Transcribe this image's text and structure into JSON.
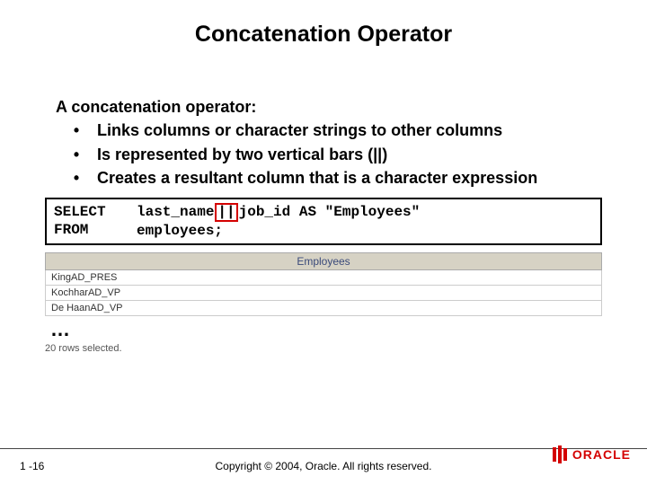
{
  "title": "Concatenation Operator",
  "lead": "A concatenation operator:",
  "bullets": [
    "Links columns or character strings to other columns",
    "Is represented by two vertical bars (||)",
    "Creates a resultant column that is a character expression"
  ],
  "code": {
    "kw1": "SELECT",
    "kw2": "FROM",
    "expr_pre": "last_name",
    "expr_op": "||",
    "expr_post": "job_id AS \"Employees\"",
    "from": "employees;"
  },
  "result": {
    "header": "Employees",
    "rows": [
      "KingAD_PRES",
      "KochharAD_VP",
      "De HaanAD_VP"
    ],
    "ellipsis": "…",
    "rowcount": "20 rows selected."
  },
  "footer": {
    "pagenum": "1 -16",
    "copyright": "Copyright © 2004, Oracle. All rights reserved.",
    "logo_text": "ORACLE"
  }
}
